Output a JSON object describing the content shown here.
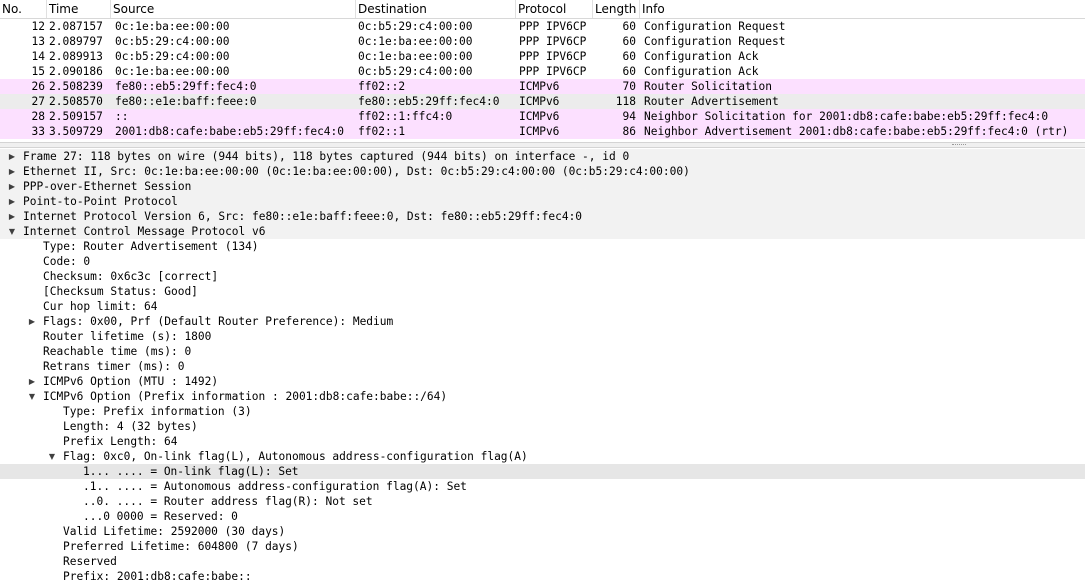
{
  "packet_list": {
    "columns": [
      "No.",
      "Time",
      "Source",
      "Destination",
      "Protocol",
      "Length",
      "Info"
    ],
    "rows": [
      {
        "no": "12",
        "time": "2.087157",
        "src": "0c:1e:ba:ee:00:00",
        "dst": "0c:b5:29:c4:00:00",
        "proto": "PPP IPV6CP",
        "len": "60",
        "info": "Configuration Request",
        "style": "white"
      },
      {
        "no": "13",
        "time": "2.089797",
        "src": "0c:b5:29:c4:00:00",
        "dst": "0c:1e:ba:ee:00:00",
        "proto": "PPP IPV6CP",
        "len": "60",
        "info": "Configuration Request",
        "style": "white"
      },
      {
        "no": "14",
        "time": "2.089913",
        "src": "0c:b5:29:c4:00:00",
        "dst": "0c:1e:ba:ee:00:00",
        "proto": "PPP IPV6CP",
        "len": "60",
        "info": "Configuration Ack",
        "style": "white"
      },
      {
        "no": "15",
        "time": "2.090186",
        "src": "0c:1e:ba:ee:00:00",
        "dst": "0c:b5:29:c4:00:00",
        "proto": "PPP IPV6CP",
        "len": "60",
        "info": "Configuration Ack",
        "style": "white"
      },
      {
        "no": "26",
        "time": "2.508239",
        "src": "fe80::eb5:29ff:fec4:0",
        "dst": "ff02::2",
        "proto": "ICMPv6",
        "len": "70",
        "info": "Router Solicitation",
        "style": "pink"
      },
      {
        "no": "27",
        "time": "2.508570",
        "src": "fe80::e1e:baff:feee:0",
        "dst": "fe80::eb5:29ff:fec4:0",
        "proto": "ICMPv6",
        "len": "118",
        "info": "Router Advertisement",
        "style": "selected"
      },
      {
        "no": "28",
        "time": "2.509157",
        "src": "::",
        "dst": "ff02::1:ffc4:0",
        "proto": "ICMPv6",
        "len": "94",
        "info": "Neighbor Solicitation for 2001:db8:cafe:babe:eb5:29ff:fec4:0",
        "style": "pink"
      },
      {
        "no": "33",
        "time": "3.509729",
        "src": "2001:db8:cafe:babe:eb5:29ff:fec4:0",
        "dst": "ff02::1",
        "proto": "ICMPv6",
        "len": "86",
        "info": "Neighbor Advertisement 2001:db8:cafe:babe:eb5:29ff:fec4:0 (rtr)",
        "style": "pink"
      }
    ]
  },
  "details": [
    {
      "level": 0,
      "arrow": "right",
      "text": "Frame 27: 118 bytes on wire (944 bits), 118 bytes captured (944 bits) on interface -, id 0",
      "style": "top"
    },
    {
      "level": 0,
      "arrow": "right",
      "text": "Ethernet II, Src: 0c:1e:ba:ee:00:00 (0c:1e:ba:ee:00:00), Dst: 0c:b5:29:c4:00:00 (0c:b5:29:c4:00:00)",
      "style": "top"
    },
    {
      "level": 0,
      "arrow": "right",
      "text": "PPP-over-Ethernet Session",
      "style": "top"
    },
    {
      "level": 0,
      "arrow": "right",
      "text": "Point-to-Point Protocol",
      "style": "top"
    },
    {
      "level": 0,
      "arrow": "right",
      "text": "Internet Protocol Version 6, Src: fe80::e1e:baff:feee:0, Dst: fe80::eb5:29ff:fec4:0",
      "style": "top"
    },
    {
      "level": 0,
      "arrow": "down",
      "text": "Internet Control Message Protocol v6",
      "style": "top"
    },
    {
      "level": 1,
      "arrow": "",
      "text": "Type: Router Advertisement (134)",
      "style": ""
    },
    {
      "level": 1,
      "arrow": "",
      "text": "Code: 0",
      "style": ""
    },
    {
      "level": 1,
      "arrow": "",
      "text": "Checksum: 0x6c3c [correct]",
      "style": ""
    },
    {
      "level": 1,
      "arrow": "",
      "text": "[Checksum Status: Good]",
      "style": ""
    },
    {
      "level": 1,
      "arrow": "",
      "text": "Cur hop limit: 64",
      "style": ""
    },
    {
      "level": 1,
      "arrow": "right",
      "text": "Flags: 0x00, Prf (Default Router Preference): Medium",
      "style": ""
    },
    {
      "level": 1,
      "arrow": "",
      "text": "Router lifetime (s): 1800",
      "style": ""
    },
    {
      "level": 1,
      "arrow": "",
      "text": "Reachable time (ms): 0",
      "style": ""
    },
    {
      "level": 1,
      "arrow": "",
      "text": "Retrans timer (ms): 0",
      "style": ""
    },
    {
      "level": 1,
      "arrow": "right",
      "text": "ICMPv6 Option (MTU : 1492)",
      "style": ""
    },
    {
      "level": 1,
      "arrow": "down",
      "text": "ICMPv6 Option (Prefix information : 2001:db8:cafe:babe::/64)",
      "style": ""
    },
    {
      "level": 2,
      "arrow": "",
      "text": "Type: Prefix information (3)",
      "style": ""
    },
    {
      "level": 2,
      "arrow": "",
      "text": "Length: 4 (32 bytes)",
      "style": ""
    },
    {
      "level": 2,
      "arrow": "",
      "text": "Prefix Length: 64",
      "style": ""
    },
    {
      "level": 2,
      "arrow": "down",
      "text": "Flag: 0xc0, On-link flag(L), Autonomous address-configuration flag(A)",
      "style": ""
    },
    {
      "level": 3,
      "arrow": "",
      "text": "1... .... = On-link flag(L): Set",
      "style": "sel"
    },
    {
      "level": 3,
      "arrow": "",
      "text": ".1.. .... = Autonomous address-configuration flag(A): Set",
      "style": ""
    },
    {
      "level": 3,
      "arrow": "",
      "text": "..0. .... = Router address flag(R): Not set",
      "style": ""
    },
    {
      "level": 3,
      "arrow": "",
      "text": "...0 0000 = Reserved: 0",
      "style": ""
    },
    {
      "level": 2,
      "arrow": "",
      "text": "Valid Lifetime: 2592000 (30 days)",
      "style": ""
    },
    {
      "level": 2,
      "arrow": "",
      "text": "Preferred Lifetime: 604800 (7 days)",
      "style": ""
    },
    {
      "level": 2,
      "arrow": "",
      "text": "Reserved",
      "style": ""
    },
    {
      "level": 2,
      "arrow": "",
      "text": "Prefix: 2001:db8:cafe:babe::",
      "style": ""
    }
  ]
}
